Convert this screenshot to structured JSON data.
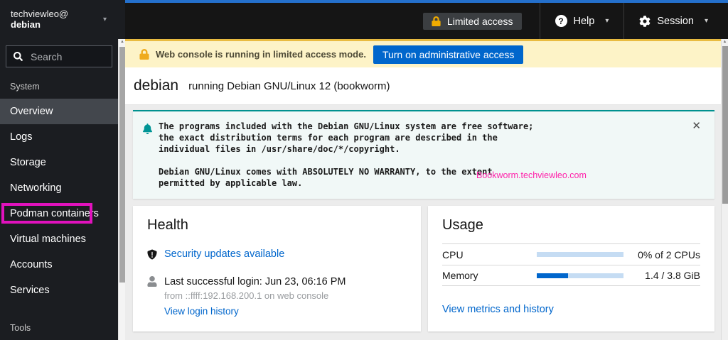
{
  "masthead": {
    "user": "techviewleo@",
    "host": "debian",
    "limited_access_label": "Limited access",
    "help_label": "Help",
    "session_label": "Session"
  },
  "sidebar": {
    "search_placeholder": "Search",
    "system_section_label": "System",
    "tools_section_label": "Tools",
    "items": [
      "Overview",
      "Logs",
      "Storage",
      "Networking",
      "Podman containers",
      "Virtual machines",
      "Accounts",
      "Services"
    ],
    "selected_item": "Overview",
    "annotated_item": "Podman containers"
  },
  "banner": {
    "message": "Web console is running in limited access mode.",
    "button_label": "Turn on administrative access"
  },
  "page": {
    "hostname": "debian",
    "os": "running Debian GNU/Linux 12 (bookworm)"
  },
  "alert": {
    "text": "The programs included with the Debian GNU/Linux system are free software;\nthe exact distribution terms for each program are described in the\nindividual files in /usr/share/doc/*/copyright.\n\nDebian GNU/Linux comes with ABSOLUTELY NO WARRANTY, to the extent\npermitted by applicable law.",
    "watermark": "Bookworm.techviewleo.com"
  },
  "health": {
    "title": "Health",
    "security_link": "Security updates available",
    "last_login": "Last successful login: Jun 23, 06:16 PM",
    "login_detail": "from ::ffff:192.168.200.1 on web console",
    "login_history_link": "View login history"
  },
  "usage": {
    "title": "Usage",
    "rows": [
      {
        "label": "CPU",
        "value": "0% of 2 CPUs",
        "percent": 0
      },
      {
        "label": "Memory",
        "value": "1.4 / 3.8 GiB",
        "percent": 36
      }
    ],
    "metrics_link": "View metrics and history"
  },
  "icons": {
    "caret_down": "▾",
    "close": "✕",
    "scroll_up": "▲",
    "question": "?"
  },
  "colors": {
    "accent_blue": "#0066cc",
    "alert_teal": "#009596",
    "banner_gold": "#f0ab00",
    "annotation_magenta": "#e112bd",
    "watermark_pink": "#ff22aa",
    "masthead_strip_blue": "#2470cc",
    "memory_bar_fill": "#0066cc",
    "bar_track": "#c5dcf3"
  }
}
